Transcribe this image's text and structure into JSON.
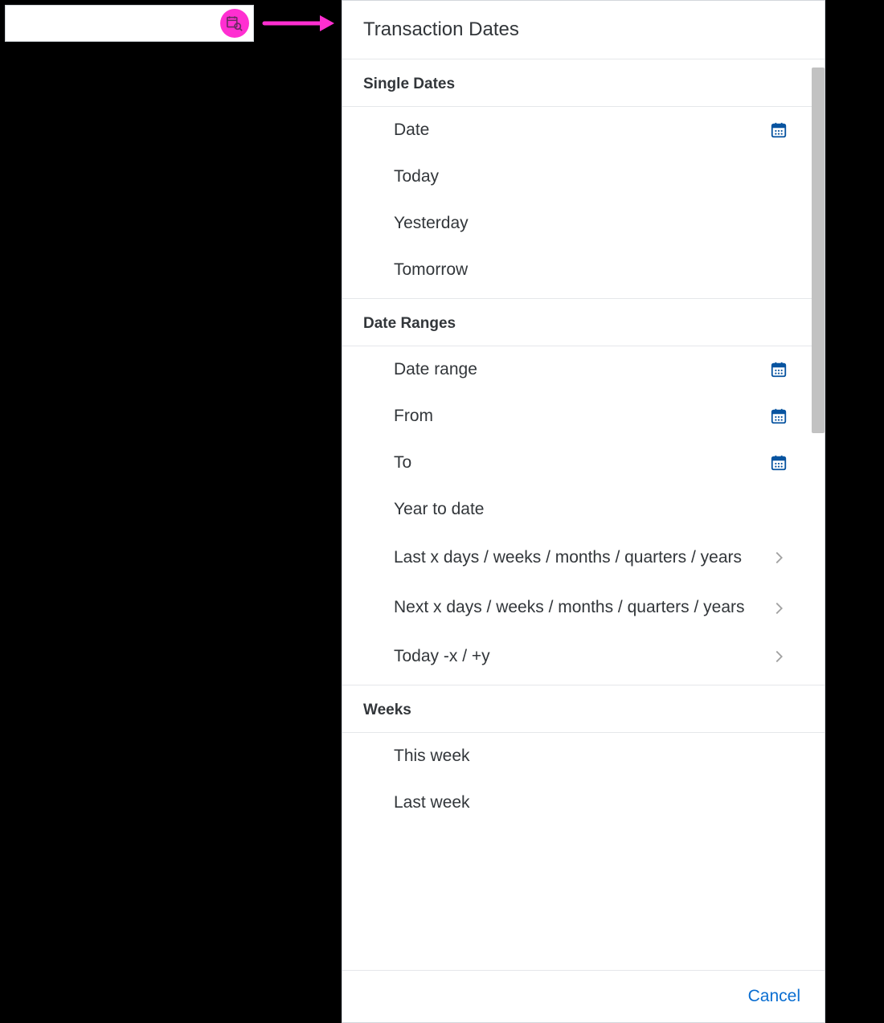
{
  "left_input": {
    "value": "",
    "placeholder": ""
  },
  "panel": {
    "title": "Transaction Dates",
    "sections": [
      {
        "id": "single",
        "heading": "Single Dates",
        "items": [
          {
            "id": "date",
            "label": "Date",
            "trailing": "calendar"
          },
          {
            "id": "today",
            "label": "Today",
            "trailing": null
          },
          {
            "id": "yesterday",
            "label": "Yesterday",
            "trailing": null
          },
          {
            "id": "tomorrow",
            "label": "Tomorrow",
            "trailing": null
          }
        ]
      },
      {
        "id": "ranges",
        "heading": "Date Ranges",
        "items": [
          {
            "id": "date_range",
            "label": "Date range",
            "trailing": "calendar"
          },
          {
            "id": "from",
            "label": "From",
            "trailing": "calendar"
          },
          {
            "id": "to",
            "label": "To",
            "trailing": "calendar"
          },
          {
            "id": "ytd",
            "label": "Year to date",
            "trailing": null
          },
          {
            "id": "last_x",
            "label": "Last x days / weeks / months / quarters / years",
            "trailing": "chevron",
            "multiline": true
          },
          {
            "id": "next_x",
            "label": "Next x days / weeks / months / quarters / years",
            "trailing": "chevron",
            "multiline": true
          },
          {
            "id": "today_x_y",
            "label": "Today -x / +y",
            "trailing": "chevron"
          }
        ]
      },
      {
        "id": "weeks",
        "heading": "Weeks",
        "items": [
          {
            "id": "this_week",
            "label": "This week",
            "trailing": null
          },
          {
            "id": "last_week",
            "label": "Last week",
            "trailing": null
          }
        ]
      }
    ],
    "footer": {
      "cancel_label": "Cancel"
    }
  },
  "colors": {
    "accent_blue": "#0a6ed1",
    "highlight_magenta": "#ff2fd1",
    "icon_blue": "#0854a0"
  }
}
